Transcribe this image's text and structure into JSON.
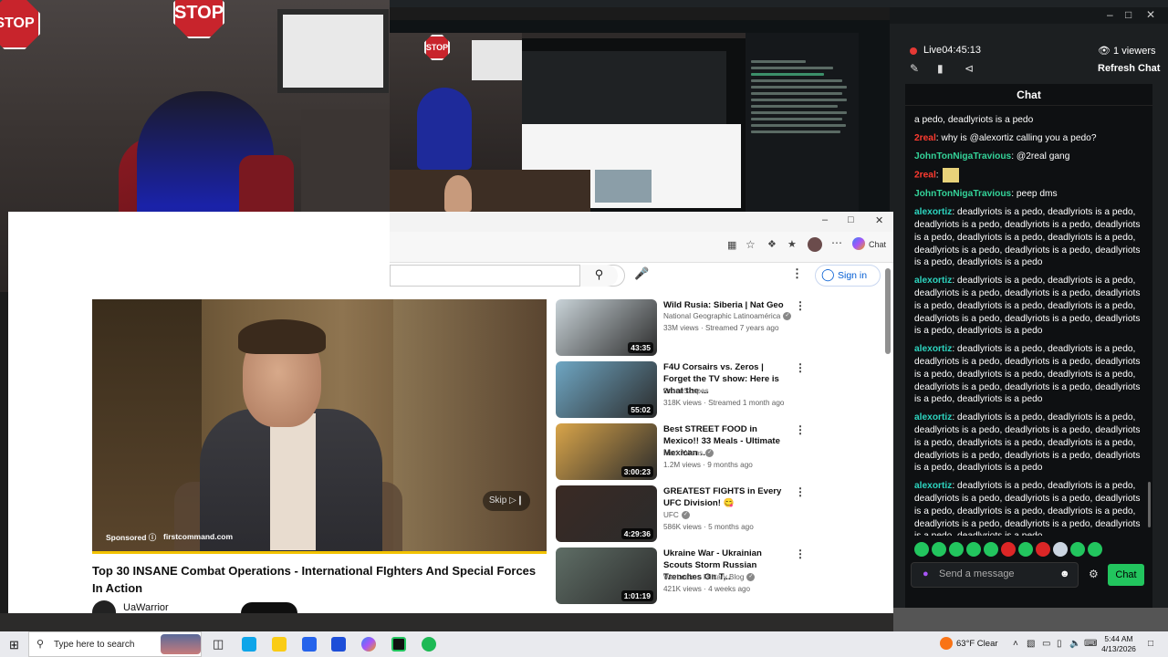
{
  "webcam": {
    "stop_sign_text": "STOP",
    "stop_sign_text_left": "STOP"
  },
  "preview": {
    "stop_sign_text": "STOP"
  },
  "chat_panel": {
    "live_label": "Live",
    "live_time": "04:45:13",
    "viewers": "1 viewers",
    "refresh_label": "Refresh Chat",
    "title": "Chat",
    "messages": [
      {
        "user": "",
        "text": "a pedo, deadlyriots is a pedo",
        "color": "white"
      },
      {
        "user": "2real",
        "text": ": why is @alexortiz calling you a pedo?",
        "color": "red"
      },
      {
        "user": "JohnTonNigaTravious",
        "text": ": @2real gang",
        "color": "green"
      },
      {
        "user": "2real",
        "text": ":",
        "color": "red"
      },
      {
        "user": "JohnTonNigaTravious",
        "text": ": peep dms",
        "color": "green"
      },
      {
        "user": "alexortiz",
        "text": ": deadlyriots is a pedo, deadlyriots is a pedo, deadlyriots is a pedo, deadlyriots is a pedo, deadlyriots is a pedo, deadlyriots is a pedo, deadlyriots is a pedo, deadlyriots is a pedo, deadlyriots is a pedo, deadlyriots is a pedo, deadlyriots is a pedo",
        "color": "cyan"
      },
      {
        "user": "alexortiz",
        "text": ": deadlyriots is a pedo, deadlyriots is a pedo, deadlyriots is a pedo, deadlyriots is a pedo, deadlyriots is a pedo, deadlyriots is a pedo, deadlyriots is a pedo, deadlyriots is a pedo, deadlyriots is a pedo, deadlyriots is a pedo, deadlyriots is a pedo",
        "color": "cyan"
      },
      {
        "user": "alexortiz",
        "text": ": deadlyriots is a pedo, deadlyriots is a pedo, deadlyriots is a pedo, deadlyriots is a pedo, deadlyriots is a pedo, deadlyriots is a pedo, deadlyriots is a pedo, deadlyriots is a pedo, deadlyriots is a pedo, deadlyriots is a pedo, deadlyriots is a pedo",
        "color": "cyan"
      },
      {
        "user": "alexortiz",
        "text": ": deadlyriots is a pedo, deadlyriots is a pedo, deadlyriots is a pedo, deadlyriots is a pedo, deadlyriots is a pedo, deadlyriots is a pedo, deadlyriots is a pedo, deadlyriots is a pedo, deadlyriots is a pedo, deadlyriots is a pedo, deadlyriots is a pedo",
        "color": "cyan"
      },
      {
        "user": "alexortiz",
        "text": ": deadlyriots is a pedo, deadlyriots is a pedo, deadlyriots is a pedo, deadlyriots is a pedo, deadlyriots is a pedo, deadlyriots is a pedo, deadlyriots is a pedo, deadlyriots is a pedo, deadlyriots is a pedo, deadlyriots is a pedo, deadlyriots is a pedo",
        "color": "cyan"
      }
    ],
    "send_placeholder": "Send a message",
    "chat_button": "Chat"
  },
  "browser": {
    "copilot_label": "Chat",
    "signin_label": "Sign in",
    "video": {
      "sponsored_label": "Sponsored",
      "ad_domain": "firstcommand.com",
      "skip_label": "Skip",
      "title": "Top 30 INSANE Combat Operations - International FIghters And Special Forces In Action",
      "channel": "UaWarrior"
    },
    "recommended": [
      {
        "title": "Wild Rusia: Siberia | Nat Geo",
        "channel": "National Geographic Latinoamérica",
        "meta": "33M views · Streamed 7 years ago",
        "duration": "43:35",
        "verified": true,
        "thumb_color": "#c9d3d8"
      },
      {
        "title": "F4U Corsairs vs. Zeros | Forget the TV show: Here is what the ...",
        "channel": "DroneScapes",
        "meta": "318K views · Streamed 1 month ago",
        "duration": "55:02",
        "verified": false,
        "thumb_color": "#6fa7c4"
      },
      {
        "title": "Best STREET FOOD in Mexico!! 33 Meals - Ultimate Mexican ...",
        "channel": "Mark Wiens",
        "meta": "1.2M views · 9 months ago",
        "duration": "3:00:23",
        "verified": true,
        "thumb_color": "#d9a54a"
      },
      {
        "title": "GREATEST FIGHTS in Every UFC Division! 😋",
        "channel": "UFC",
        "meta": "586K views · 5 months ago",
        "duration": "4:29:36",
        "verified": true,
        "thumb_color": "#3a2a24"
      },
      {
        "title": "Ukraine War - Ukrainian Scouts Storm Russian Trenches On T...",
        "channel": "WarLeaks - Military Blog",
        "meta": "421K views · 4 weeks ago",
        "duration": "1:01:19",
        "verified": true,
        "thumb_color": "#5f6e66"
      }
    ]
  },
  "taskbar": {
    "search_placeholder": "Type here to search",
    "weather": "63°F  Clear",
    "time": "5:44 AM",
    "date": "4/13/2026"
  }
}
